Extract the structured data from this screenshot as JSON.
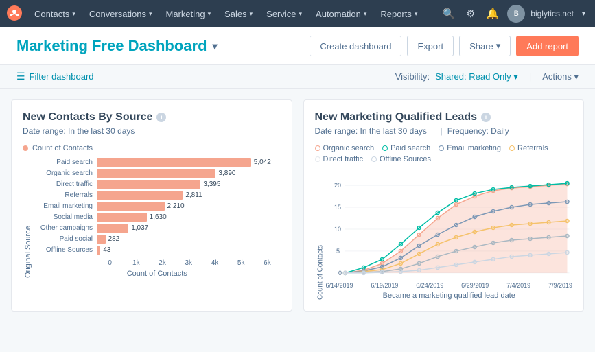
{
  "nav": {
    "logo_label": "HubSpot",
    "items": [
      {
        "label": "Contacts",
        "has_caret": true
      },
      {
        "label": "Conversations",
        "has_caret": true
      },
      {
        "label": "Marketing",
        "has_caret": true
      },
      {
        "label": "Sales",
        "has_caret": true
      },
      {
        "label": "Service",
        "has_caret": true
      },
      {
        "label": "Automation",
        "has_caret": true
      },
      {
        "label": "Reports",
        "has_caret": true
      }
    ],
    "domain": "biglytics.net"
  },
  "header": {
    "title": "Marketing Free Dashboard",
    "buttons": {
      "create": "Create dashboard",
      "export": "Export",
      "share": "Share",
      "add_report": "Add report"
    }
  },
  "filter_bar": {
    "filter_label": "Filter dashboard",
    "visibility_label": "Visibility:",
    "visibility_value": "Shared: Read Only",
    "actions_label": "Actions"
  },
  "charts": {
    "bar_chart": {
      "title": "New Contacts By Source",
      "info": "i",
      "date_range": "Date range: In the last 30 days",
      "legend_label": "Count of Contacts",
      "legend_color": "#f5a58e",
      "y_axis_label": "Original Source",
      "x_axis_label": "Count of Contacts",
      "bars": [
        {
          "label": "Paid search",
          "value": 5042,
          "pct": 82
        },
        {
          "label": "Organic search",
          "value": 3890,
          "pct": 64
        },
        {
          "label": "Direct traffic",
          "value": 3395,
          "pct": 56
        },
        {
          "label": "Referrals",
          "value": 2811,
          "pct": 46
        },
        {
          "label": "Email marketing",
          "value": 2210,
          "pct": 36
        },
        {
          "label": "Social media",
          "value": 1630,
          "pct": 27
        },
        {
          "label": "Other campaigns",
          "value": 1037,
          "pct": 17
        },
        {
          "label": "Paid social",
          "value": 282,
          "pct": 5
        },
        {
          "label": "Offline Sources",
          "value": 43,
          "pct": 1
        }
      ],
      "x_axis_ticks": [
        "0",
        "1k",
        "2k",
        "3k",
        "4k",
        "5k",
        "6k"
      ]
    },
    "line_chart": {
      "title": "New Marketing Qualified Leads",
      "info": "i",
      "date_range": "Date range: In the last 30 days",
      "frequency": "Frequency: Daily",
      "y_axis_label": "Count of Contacts",
      "x_axis_label": "Became a marketing qualified lead date",
      "y_ticks": [
        "0",
        "5",
        "10",
        "15",
        "20"
      ],
      "x_ticks": [
        "6/14/2019",
        "6/19/2019",
        "6/24/2019",
        "6/29/2019",
        "7/4/2019",
        "7/9/2019"
      ],
      "legend": [
        {
          "label": "Organic search",
          "color": "#f5a58e"
        },
        {
          "label": "Paid search",
          "color": "#00bda5"
        },
        {
          "label": "Email marketing",
          "color": "#7c98b6"
        },
        {
          "label": "Referrals",
          "color": "#f5c26b"
        },
        {
          "label": "Direct traffic",
          "color": "#e5e8ed"
        },
        {
          "label": "Offline Sources",
          "color": "#cbd6e2"
        }
      ]
    }
  }
}
